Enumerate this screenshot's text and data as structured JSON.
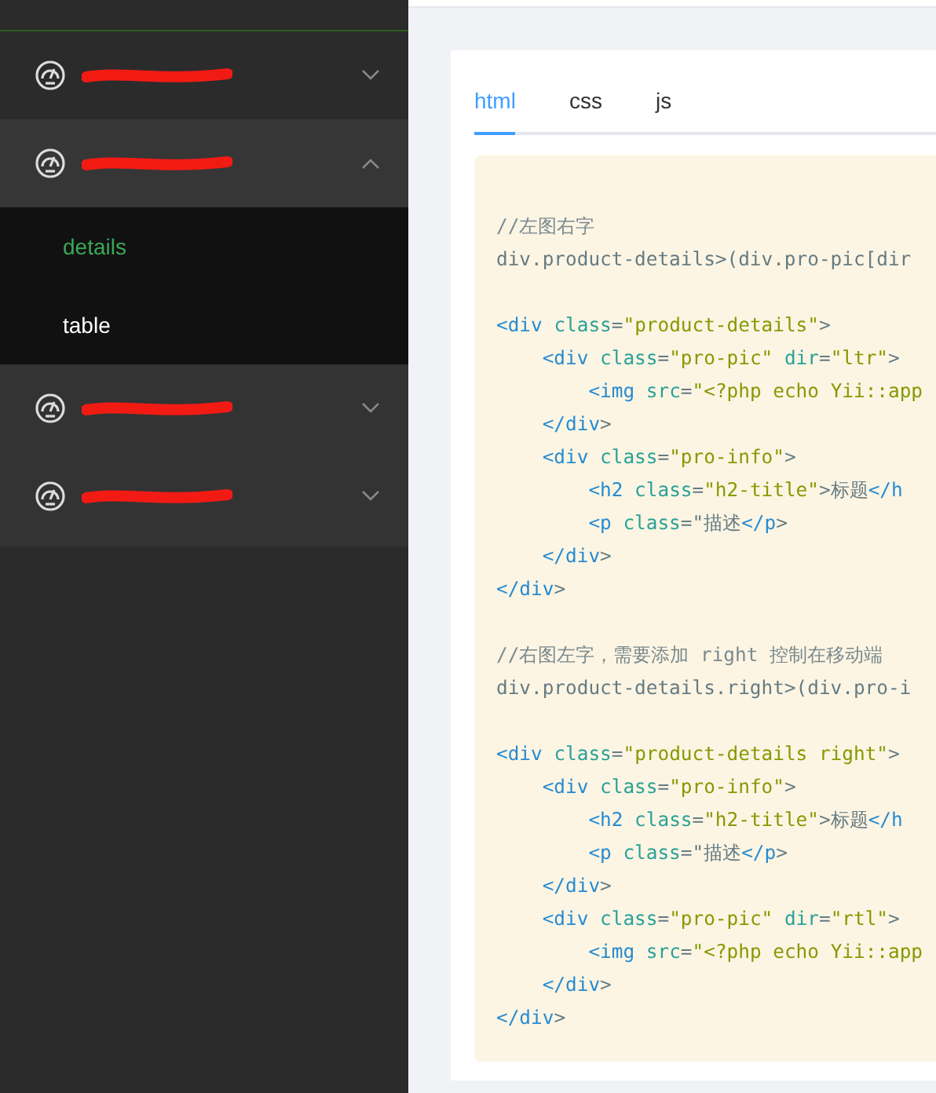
{
  "sidebar": {
    "items": [
      {
        "redacted": true,
        "expanded": false
      },
      {
        "redacted": true,
        "expanded": true,
        "children": [
          {
            "label": "details",
            "selected": true
          },
          {
            "label": "table",
            "selected": false
          }
        ]
      },
      {
        "redacted": true,
        "expanded": false
      },
      {
        "redacted": true,
        "expanded": false
      }
    ]
  },
  "tabs": [
    {
      "label": "html",
      "selected": true
    },
    {
      "label": "css",
      "selected": false
    },
    {
      "label": "js",
      "selected": false
    }
  ],
  "code_blocks": [
    [
      [
        {
          "kind": "comment",
          "text": "//左图右字"
        }
      ],
      [
        {
          "kind": "plain",
          "text": "div.product-details>(div.pro-pic[dir"
        }
      ]
    ],
    [
      [
        {
          "kind": "tag",
          "text": "<div"
        },
        {
          "kind": "attr",
          "text": " class"
        },
        {
          "kind": "plain",
          "text": "="
        },
        {
          "kind": "string",
          "text": "\"product-details\""
        },
        {
          "kind": "plain",
          "text": ">"
        }
      ],
      [
        {
          "kind": "tag",
          "text": "    <div"
        },
        {
          "kind": "attr",
          "text": " class"
        },
        {
          "kind": "plain",
          "text": "="
        },
        {
          "kind": "string",
          "text": "\"pro-pic\""
        },
        {
          "kind": "attr",
          "text": " dir"
        },
        {
          "kind": "plain",
          "text": "="
        },
        {
          "kind": "string",
          "text": "\"ltr\""
        },
        {
          "kind": "plain",
          "text": ">"
        }
      ],
      [
        {
          "kind": "tag",
          "text": "        <img"
        },
        {
          "kind": "attr",
          "text": " src"
        },
        {
          "kind": "plain",
          "text": "="
        },
        {
          "kind": "string",
          "text": "\"<?php echo Yii::app"
        }
      ],
      [
        {
          "kind": "tag",
          "text": "    </div"
        },
        {
          "kind": "plain",
          "text": ">"
        }
      ],
      [
        {
          "kind": "tag",
          "text": "    <div"
        },
        {
          "kind": "attr",
          "text": " class"
        },
        {
          "kind": "plain",
          "text": "="
        },
        {
          "kind": "string",
          "text": "\"pro-info\""
        },
        {
          "kind": "plain",
          "text": ">"
        }
      ],
      [
        {
          "kind": "tag",
          "text": "        <h2"
        },
        {
          "kind": "attr",
          "text": " class"
        },
        {
          "kind": "plain",
          "text": "="
        },
        {
          "kind": "string",
          "text": "\"h2-title\""
        },
        {
          "kind": "plain",
          "text": ">标题"
        },
        {
          "kind": "tag",
          "text": "</h"
        }
      ],
      [
        {
          "kind": "tag",
          "text": "        <p"
        },
        {
          "kind": "attr",
          "text": " class"
        },
        {
          "kind": "plain",
          "text": "=\"描述"
        },
        {
          "kind": "tag",
          "text": "</p"
        },
        {
          "kind": "plain",
          "text": ">"
        }
      ],
      [
        {
          "kind": "tag",
          "text": "    </div"
        },
        {
          "kind": "plain",
          "text": ">"
        }
      ],
      [
        {
          "kind": "tag",
          "text": "</div"
        },
        {
          "kind": "plain",
          "text": ">"
        }
      ]
    ],
    [
      [
        {
          "kind": "comment",
          "text": "//右图左字，需要添加 right 控制在移动端"
        }
      ],
      [
        {
          "kind": "plain",
          "text": "div.product-details.right>(div.pro-i"
        }
      ]
    ],
    [
      [
        {
          "kind": "tag",
          "text": "<div"
        },
        {
          "kind": "attr",
          "text": " class"
        },
        {
          "kind": "plain",
          "text": "="
        },
        {
          "kind": "string",
          "text": "\"product-details right\""
        },
        {
          "kind": "plain",
          "text": ">"
        }
      ],
      [
        {
          "kind": "tag",
          "text": "    <div"
        },
        {
          "kind": "attr",
          "text": " class"
        },
        {
          "kind": "plain",
          "text": "="
        },
        {
          "kind": "string",
          "text": "\"pro-info\""
        },
        {
          "kind": "plain",
          "text": ">"
        }
      ],
      [
        {
          "kind": "tag",
          "text": "        <h2"
        },
        {
          "kind": "attr",
          "text": " class"
        },
        {
          "kind": "plain",
          "text": "="
        },
        {
          "kind": "string",
          "text": "\"h2-title\""
        },
        {
          "kind": "plain",
          "text": ">标题"
        },
        {
          "kind": "tag",
          "text": "</h"
        }
      ],
      [
        {
          "kind": "tag",
          "text": "        <p"
        },
        {
          "kind": "attr",
          "text": " class"
        },
        {
          "kind": "plain",
          "text": "=\"描述"
        },
        {
          "kind": "tag",
          "text": "</p"
        },
        {
          "kind": "plain",
          "text": ">"
        }
      ],
      [
        {
          "kind": "tag",
          "text": "    </div"
        },
        {
          "kind": "plain",
          "text": ">"
        }
      ],
      [
        {
          "kind": "tag",
          "text": "    <div"
        },
        {
          "kind": "attr",
          "text": " class"
        },
        {
          "kind": "plain",
          "text": "="
        },
        {
          "kind": "string",
          "text": "\"pro-pic\""
        },
        {
          "kind": "attr",
          "text": " dir"
        },
        {
          "kind": "plain",
          "text": "="
        },
        {
          "kind": "string",
          "text": "\"rtl\""
        },
        {
          "kind": "plain",
          "text": ">"
        }
      ],
      [
        {
          "kind": "tag",
          "text": "        <img"
        },
        {
          "kind": "attr",
          "text": " src"
        },
        {
          "kind": "plain",
          "text": "="
        },
        {
          "kind": "string",
          "text": "\"<?php echo Yii::app"
        }
      ],
      [
        {
          "kind": "tag",
          "text": "    </div"
        },
        {
          "kind": "plain",
          "text": ">"
        }
      ],
      [
        {
          "kind": "tag",
          "text": "</div"
        },
        {
          "kind": "plain",
          "text": ">"
        }
      ]
    ]
  ]
}
